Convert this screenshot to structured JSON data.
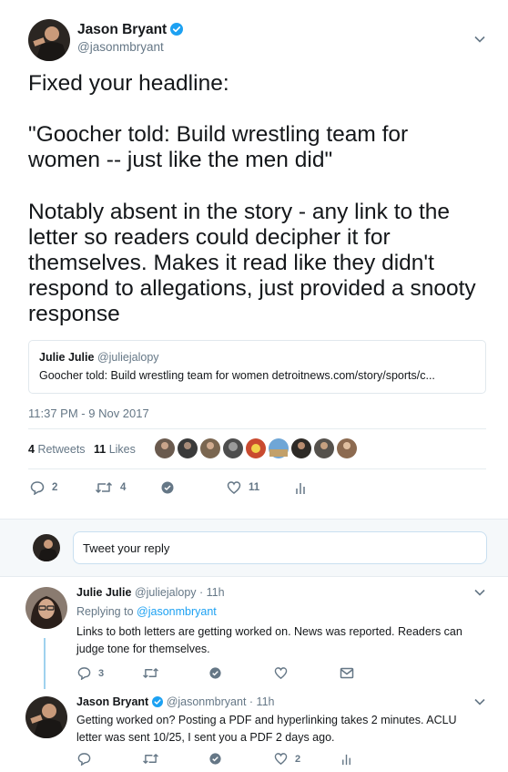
{
  "main_tweet": {
    "author": {
      "name": "Jason Bryant",
      "handle": "@jasonmbryant",
      "verified": true
    },
    "text_lines": [
      "Fixed your headline:",
      "\"Goocher told: Build wrestling team for women -- just like the men did\"",
      "Notably absent in the story - any link to the letter so readers could decipher it for themselves. Makes it read like they didn't respond to allegations, just provided a snooty response"
    ],
    "quoted": {
      "name": "Julie Julie",
      "handle": "@juliejalopy",
      "text": "Goocher told: Build wrestling team for women detroitnews.com/story/sports/c..."
    },
    "timestamp": "11:37 PM - 9 Nov 2017",
    "stats": {
      "retweets_count": "4",
      "retweets_label": "Retweets",
      "likes_count": "11",
      "likes_label": "Likes"
    },
    "liker_avatar_count": 9,
    "actions": {
      "replies": "2",
      "retweets": "4",
      "likes": "11"
    }
  },
  "reply_composer": {
    "placeholder": "Tweet your reply"
  },
  "replies": [
    {
      "name": "Julie Julie",
      "handle": "@juliejalopy",
      "time": "· 11h",
      "replying_to_label": "Replying to",
      "replying_to_handle": "@jasonmbryant",
      "text": "Links to both letters are getting worked on. News was reported. Readers can judge tone for themselves.",
      "counts": {
        "replies": "3",
        "retweets": "",
        "likes": ""
      }
    },
    {
      "name": "Jason Bryant",
      "handle": "@jasonmbryant",
      "time": "· 11h",
      "verified": true,
      "text": "Getting worked on? Posting a PDF and hyperlinking takes 2 minutes. ACLU letter was sent 10/25, I sent you a PDF 2 days ago.",
      "counts": {
        "replies": "",
        "retweets": "",
        "likes": "2"
      }
    }
  ],
  "colors": {
    "text": "#14171a",
    "secondary": "#657786",
    "link": "#1da1f2",
    "divider": "#e6ecf0",
    "thread": "#9fd2ee",
    "composer_bg": "#f5f8fa"
  },
  "icons": [
    "chevron-down-icon",
    "verified-badge-icon",
    "reply-icon",
    "retweet-icon",
    "like-icon",
    "analytics-icon",
    "dm-icon",
    "mail-icon"
  ]
}
